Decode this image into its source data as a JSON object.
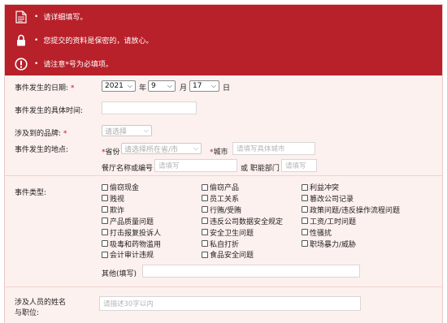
{
  "banner": [
    {
      "icon": "document-icon",
      "text": "请详细填写。"
    },
    {
      "icon": "lock-icon",
      "text": "您提交的资料是保密的，请放心。"
    },
    {
      "icon": "alert-icon",
      "text": "请注意*号为必填项。"
    }
  ],
  "bullet": "•",
  "required_mark": "*",
  "date": {
    "label": "事件发生的日期:",
    "year": "2021",
    "year_unit": "年",
    "month": "9",
    "month_unit": "月",
    "day": "17",
    "day_unit": "日"
  },
  "time": {
    "label": "事件发生的具体时间:",
    "value": ""
  },
  "brand": {
    "label": "涉及到的品牌:",
    "placeholder": "请选择"
  },
  "location": {
    "label": "事件发生的地点:",
    "province_label": "省份",
    "province_placeholder": "请选择所在省/市",
    "city_label": "城市",
    "city_placeholder": "请填写具体城市",
    "restaurant_label": "餐厅名称或编号",
    "restaurant_placeholder": "请填写",
    "or_label": "或 职能部门",
    "dept_placeholder": "请填写"
  },
  "event_type": {
    "label": "事件类型:",
    "options": [
      "偷窃现金",
      "偷窃产品",
      "利益冲突",
      "贱视",
      "员工关系",
      "篡改公司记录",
      "欺诈",
      "行贿/受贿",
      "政策问题/违反操作流程问题",
      "产品质量问题",
      "违反公司数据安全规定",
      "工资/工时问题",
      "打击报复投诉人",
      "安全卫生问题",
      "性骚扰",
      "吸毒和药物滥用",
      "私自打折",
      "职场暴力/威胁",
      "会计审计违规",
      "食品安全问题"
    ],
    "other_label": "其他(填写)",
    "other_value": ""
  },
  "persons": {
    "label_line1": "涉及人员的姓名",
    "label_line2": "与职位:",
    "placeholder": "请描述30字以内"
  },
  "colors": {
    "banner": "#b8202a",
    "form_bg": "#fdf1ef",
    "required": "#c0121b"
  }
}
